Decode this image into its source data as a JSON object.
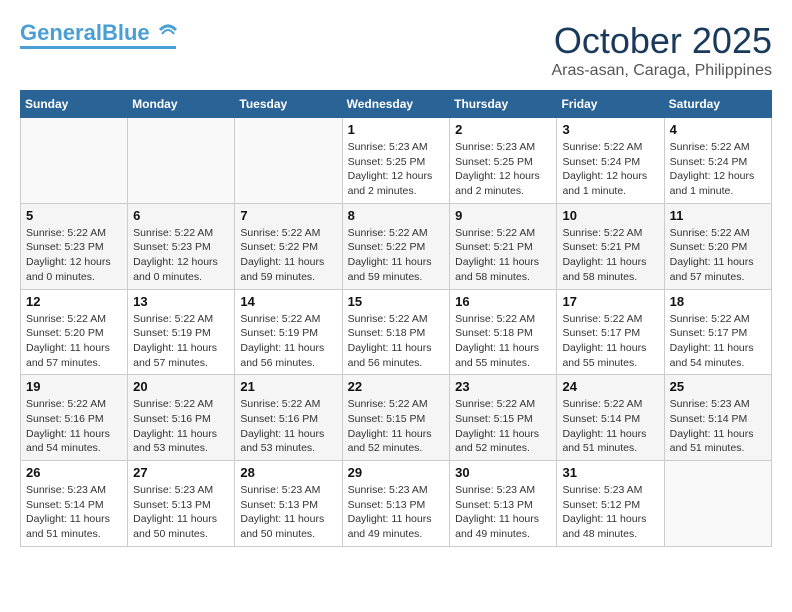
{
  "header": {
    "logo_general": "General",
    "logo_blue": "Blue",
    "month": "October 2025",
    "location": "Aras-asan, Caraga, Philippines"
  },
  "days_of_week": [
    "Sunday",
    "Monday",
    "Tuesday",
    "Wednesday",
    "Thursday",
    "Friday",
    "Saturday"
  ],
  "weeks": [
    [
      {
        "day": "",
        "info": ""
      },
      {
        "day": "",
        "info": ""
      },
      {
        "day": "",
        "info": ""
      },
      {
        "day": "1",
        "info": "Sunrise: 5:23 AM\nSunset: 5:25 PM\nDaylight: 12 hours\nand 2 minutes."
      },
      {
        "day": "2",
        "info": "Sunrise: 5:23 AM\nSunset: 5:25 PM\nDaylight: 12 hours\nand 2 minutes."
      },
      {
        "day": "3",
        "info": "Sunrise: 5:22 AM\nSunset: 5:24 PM\nDaylight: 12 hours\nand 1 minute."
      },
      {
        "day": "4",
        "info": "Sunrise: 5:22 AM\nSunset: 5:24 PM\nDaylight: 12 hours\nand 1 minute."
      }
    ],
    [
      {
        "day": "5",
        "info": "Sunrise: 5:22 AM\nSunset: 5:23 PM\nDaylight: 12 hours\nand 0 minutes."
      },
      {
        "day": "6",
        "info": "Sunrise: 5:22 AM\nSunset: 5:23 PM\nDaylight: 12 hours\nand 0 minutes."
      },
      {
        "day": "7",
        "info": "Sunrise: 5:22 AM\nSunset: 5:22 PM\nDaylight: 11 hours\nand 59 minutes."
      },
      {
        "day": "8",
        "info": "Sunrise: 5:22 AM\nSunset: 5:22 PM\nDaylight: 11 hours\nand 59 minutes."
      },
      {
        "day": "9",
        "info": "Sunrise: 5:22 AM\nSunset: 5:21 PM\nDaylight: 11 hours\nand 58 minutes."
      },
      {
        "day": "10",
        "info": "Sunrise: 5:22 AM\nSunset: 5:21 PM\nDaylight: 11 hours\nand 58 minutes."
      },
      {
        "day": "11",
        "info": "Sunrise: 5:22 AM\nSunset: 5:20 PM\nDaylight: 11 hours\nand 57 minutes."
      }
    ],
    [
      {
        "day": "12",
        "info": "Sunrise: 5:22 AM\nSunset: 5:20 PM\nDaylight: 11 hours\nand 57 minutes."
      },
      {
        "day": "13",
        "info": "Sunrise: 5:22 AM\nSunset: 5:19 PM\nDaylight: 11 hours\nand 57 minutes."
      },
      {
        "day": "14",
        "info": "Sunrise: 5:22 AM\nSunset: 5:19 PM\nDaylight: 11 hours\nand 56 minutes."
      },
      {
        "day": "15",
        "info": "Sunrise: 5:22 AM\nSunset: 5:18 PM\nDaylight: 11 hours\nand 56 minutes."
      },
      {
        "day": "16",
        "info": "Sunrise: 5:22 AM\nSunset: 5:18 PM\nDaylight: 11 hours\nand 55 minutes."
      },
      {
        "day": "17",
        "info": "Sunrise: 5:22 AM\nSunset: 5:17 PM\nDaylight: 11 hours\nand 55 minutes."
      },
      {
        "day": "18",
        "info": "Sunrise: 5:22 AM\nSunset: 5:17 PM\nDaylight: 11 hours\nand 54 minutes."
      }
    ],
    [
      {
        "day": "19",
        "info": "Sunrise: 5:22 AM\nSunset: 5:16 PM\nDaylight: 11 hours\nand 54 minutes."
      },
      {
        "day": "20",
        "info": "Sunrise: 5:22 AM\nSunset: 5:16 PM\nDaylight: 11 hours\nand 53 minutes."
      },
      {
        "day": "21",
        "info": "Sunrise: 5:22 AM\nSunset: 5:16 PM\nDaylight: 11 hours\nand 53 minutes."
      },
      {
        "day": "22",
        "info": "Sunrise: 5:22 AM\nSunset: 5:15 PM\nDaylight: 11 hours\nand 52 minutes."
      },
      {
        "day": "23",
        "info": "Sunrise: 5:22 AM\nSunset: 5:15 PM\nDaylight: 11 hours\nand 52 minutes."
      },
      {
        "day": "24",
        "info": "Sunrise: 5:22 AM\nSunset: 5:14 PM\nDaylight: 11 hours\nand 51 minutes."
      },
      {
        "day": "25",
        "info": "Sunrise: 5:23 AM\nSunset: 5:14 PM\nDaylight: 11 hours\nand 51 minutes."
      }
    ],
    [
      {
        "day": "26",
        "info": "Sunrise: 5:23 AM\nSunset: 5:14 PM\nDaylight: 11 hours\nand 51 minutes."
      },
      {
        "day": "27",
        "info": "Sunrise: 5:23 AM\nSunset: 5:13 PM\nDaylight: 11 hours\nand 50 minutes."
      },
      {
        "day": "28",
        "info": "Sunrise: 5:23 AM\nSunset: 5:13 PM\nDaylight: 11 hours\nand 50 minutes."
      },
      {
        "day": "29",
        "info": "Sunrise: 5:23 AM\nSunset: 5:13 PM\nDaylight: 11 hours\nand 49 minutes."
      },
      {
        "day": "30",
        "info": "Sunrise: 5:23 AM\nSunset: 5:13 PM\nDaylight: 11 hours\nand 49 minutes."
      },
      {
        "day": "31",
        "info": "Sunrise: 5:23 AM\nSunset: 5:12 PM\nDaylight: 11 hours\nand 48 minutes."
      },
      {
        "day": "",
        "info": ""
      }
    ]
  ]
}
